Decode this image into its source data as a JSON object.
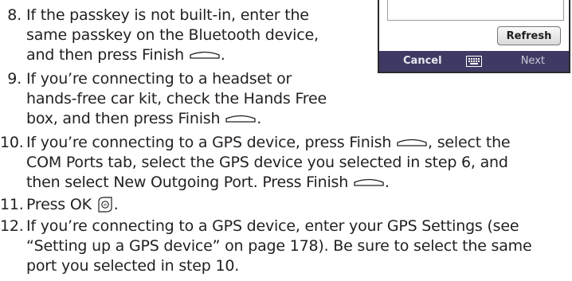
{
  "phone_screen": {
    "refresh_label": "Refresh",
    "left_softkey": "Cancel",
    "right_softkey": "Next",
    "keyboard_icon": "keyboard-icon"
  },
  "steps": [
    {
      "number": "8.",
      "lines": [
        "If the passkey is not built-in, enter the",
        "same passkey on the Bluetooth device,",
        "and then press Finish"
      ],
      "trailing": "."
    },
    {
      "number": "9.",
      "lines": [
        "If you’re connecting to a headset or",
        "hands-free car kit, check the Hands Free",
        "box, and then press Finish"
      ],
      "trailing": "."
    },
    {
      "number": "10.",
      "line1_a": "If you’re connecting to a GPS device, press Finish",
      "line1_b": ", select the",
      "line2": "COM Ports tab, select the GPS device you selected in step 6, and",
      "line3": "then select New Outgoing Port. Press Finish",
      "trailing": "."
    },
    {
      "number": "11.",
      "text": "Press OK",
      "trailing": "."
    },
    {
      "number": "12.",
      "lines": [
        "If you’re connecting to a GPS device, enter your GPS Settings (see",
        "“Setting up a GPS device” on page 178). Be sure to select the same",
        "port you selected in step 10."
      ]
    }
  ],
  "icons": {
    "finish_key": "finish-key-icon",
    "ok_key": "ok-key-icon"
  }
}
